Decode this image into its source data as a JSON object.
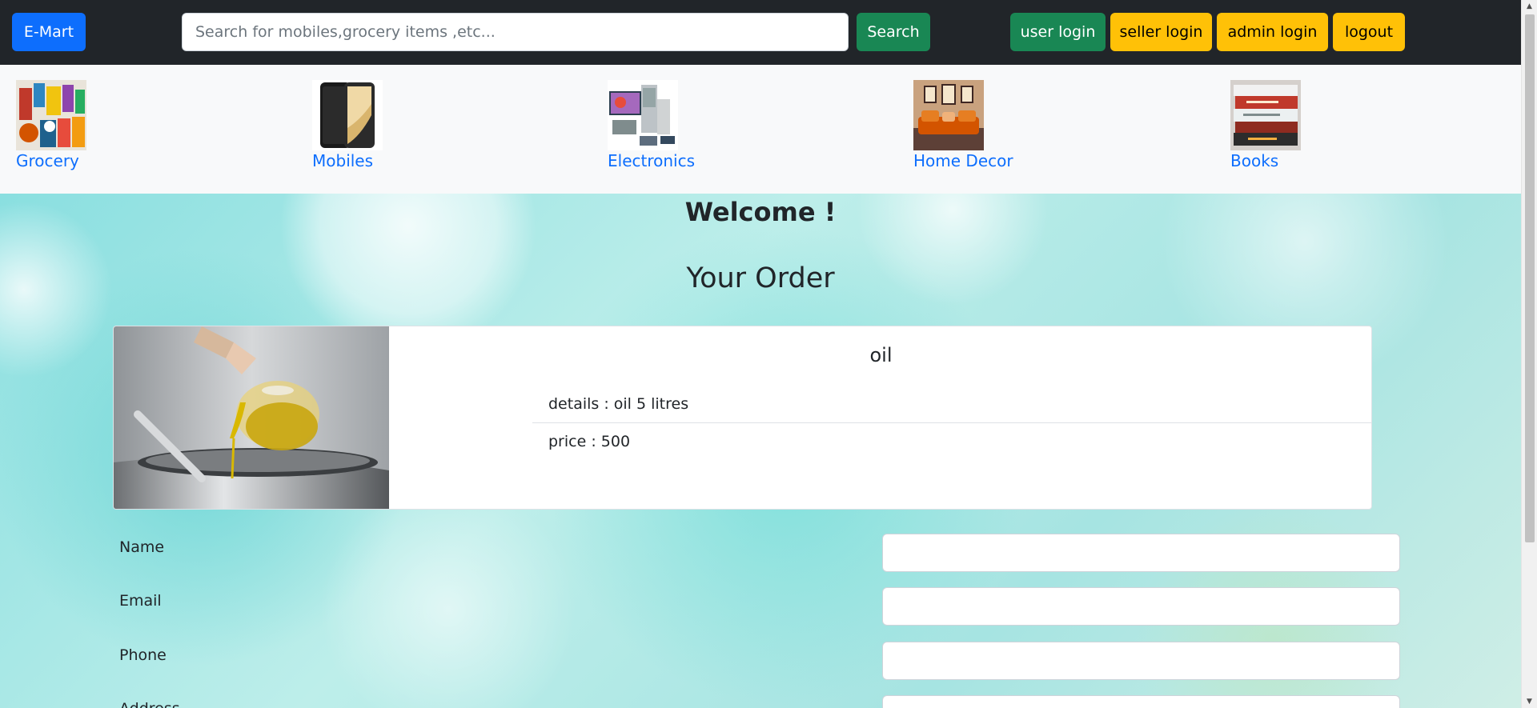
{
  "navbar": {
    "brand_label": "E-Mart",
    "search": {
      "placeholder": "Search for mobiles,grocery items ,etc...",
      "value": ""
    },
    "search_button_label": "Search",
    "user_login_label": "user login",
    "seller_login_label": "seller login",
    "admin_login_label": "admin login",
    "logout_label": "logout",
    "colors": {
      "background": "#212529",
      "primary": "#0d6efd",
      "success": "#198754",
      "warning": "#ffc107"
    }
  },
  "categories": [
    {
      "label": "Grocery",
      "icon": "grocery-icon"
    },
    {
      "label": "Mobiles",
      "icon": "mobile-phone-icon"
    },
    {
      "label": "Electronics",
      "icon": "electronics-icon"
    },
    {
      "label": "Home Decor",
      "icon": "home-decor-icon"
    },
    {
      "label": "Books",
      "icon": "books-icon"
    }
  ],
  "main": {
    "welcome": "Welcome !",
    "heading": "Your Order",
    "order": {
      "product_name": "oil",
      "details": "details : oil 5 litres",
      "price": "price : 500"
    },
    "form": {
      "fields": [
        {
          "label": "Name",
          "value": ""
        },
        {
          "label": "Email",
          "value": ""
        },
        {
          "label": "Phone",
          "value": ""
        },
        {
          "label": "Address",
          "value": ""
        }
      ]
    }
  }
}
